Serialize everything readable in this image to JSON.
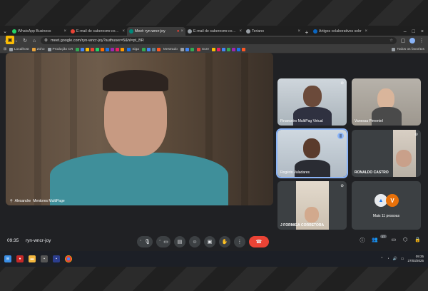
{
  "browser": {
    "tabs": [
      {
        "label": "WhatsApp Business",
        "color": "#25d366"
      },
      {
        "label": "E-mail de saberesmr.com.br",
        "color": "#ea4335"
      },
      {
        "label": "Meet: ryn-wncr-joy",
        "color": "#00897b",
        "active": true
      },
      {
        "label": "E-mail de saberesmr.com.br",
        "color": "#9aa0a6"
      },
      {
        "label": "Teriano",
        "color": "#9aa0a6"
      },
      {
        "label": "Artigos colaborativos sobr",
        "color": "#0a66c2"
      }
    ],
    "url": "meet.google.com/ryn-wncr-joy?authuser=5&hl=pt_BR",
    "bookmarks": [
      {
        "label": "Localhost",
        "color": "#9aa0a6"
      },
      {
        "label": "Zoho",
        "color": "#e8a33d"
      },
      {
        "label": "Produção CR",
        "color": "#9aa0a6"
      },
      {
        "label": "Siga",
        "color": "#1a73e8"
      },
      {
        "label": "Mestrado",
        "color": "#9aa0a6"
      },
      {
        "label": "Sure",
        "color": "#ea4335"
      }
    ],
    "all_bookmarks": "Todos os favoritos"
  },
  "meet": {
    "main": {
      "name": "Alexandre",
      "name_rest": "Mentores MultiPage"
    },
    "participants": [
      {
        "name": "Financeiro MultiPag Virtual",
        "muted": true
      },
      {
        "name": "Vanessa Pimentel",
        "muted": false
      },
      {
        "name": "Rogério Valadares",
        "speaking": true
      },
      {
        "name": "RONALDO CASTRO",
        "muted": true
      },
      {
        "name": "J FORMIGA CORRETORA",
        "muted": true
      },
      {
        "name": "Mais 11 pessoas",
        "avatar_letter": "V"
      }
    ],
    "time": "09:35",
    "code": "ryn-wncr-joy",
    "participant_count": "17"
  },
  "taskbar": {
    "time": "09:35",
    "date": "27/03/2025"
  }
}
